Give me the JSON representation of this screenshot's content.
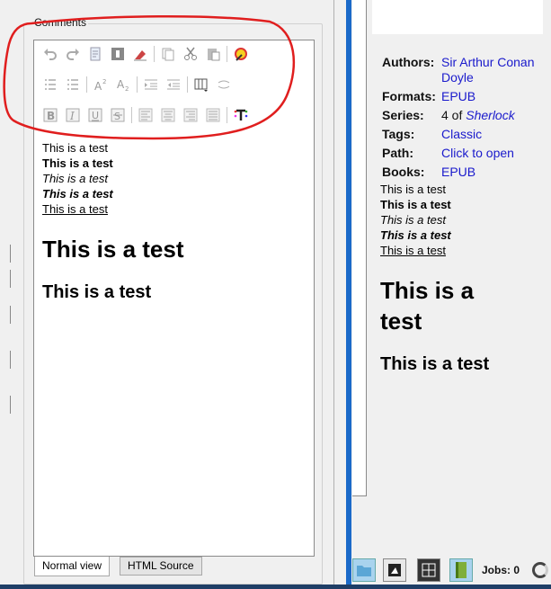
{
  "comments": {
    "group_title": "Comments",
    "toolbar_row1": [
      "undo-icon",
      "redo-icon",
      "copy-doc-icon",
      "paste-block-icon",
      "clear-format-icon",
      "|",
      "copy-icon",
      "cut-icon",
      "paste-icon",
      "|",
      "color-wheel-icon"
    ],
    "toolbar_row2": [
      "bullet-list-icon",
      "numbered-list-icon",
      "|",
      "superscript-icon",
      "subscript-icon",
      "|",
      "indent-icon",
      "outdent-icon",
      "|",
      "columns-icon",
      "link-icon"
    ],
    "toolbar_row3": [
      "bold-icon",
      "italic-icon",
      "underline-icon",
      "strikethrough-icon",
      "|",
      "align-left-icon",
      "align-center-icon",
      "align-right-icon",
      "justify-icon",
      "|",
      "text-color-icon"
    ],
    "lines": {
      "plain": "This is a test",
      "bold": "This is a test",
      "italic": "This is a test",
      "bold_italic": "This is a test",
      "underline": "This is a test",
      "h1": "This is a test",
      "h2": "This is a test"
    },
    "tabs": {
      "normal": "Normal view",
      "html": "HTML Source"
    }
  },
  "book_details": {
    "authors_label": "Authors:",
    "authors_value_line1": "Sir Arthur Conan",
    "authors_value_line2": "Doyle",
    "formats_label": "Formats:",
    "formats_value": "EPUB",
    "series_label": "Series:",
    "series_prefix": "4 of",
    "series_value": "Sherlock",
    "tags_label": "Tags:",
    "tags_value": "Classic",
    "path_label": "Path:",
    "path_value": "Click to open",
    "books_label": "Books:",
    "books_value": "EPUB",
    "lines": {
      "plain": "This is a test",
      "bold": "This is a test",
      "italic": "This is a test",
      "bold_italic": "This is a test",
      "underline": "This is a test",
      "h1_line1": "This is a",
      "h1_line2": "test",
      "h2": "This is a test"
    }
  },
  "statusbar": {
    "jobs_label": "Jobs: 0",
    "buttons": [
      "folder-icon",
      "cover-grid-icon",
      "layout-grid-icon",
      "book-icon"
    ]
  },
  "colors": {
    "accent": "#1b6ac9",
    "link": "#1a1acc",
    "annotation": "#e01e1e"
  }
}
